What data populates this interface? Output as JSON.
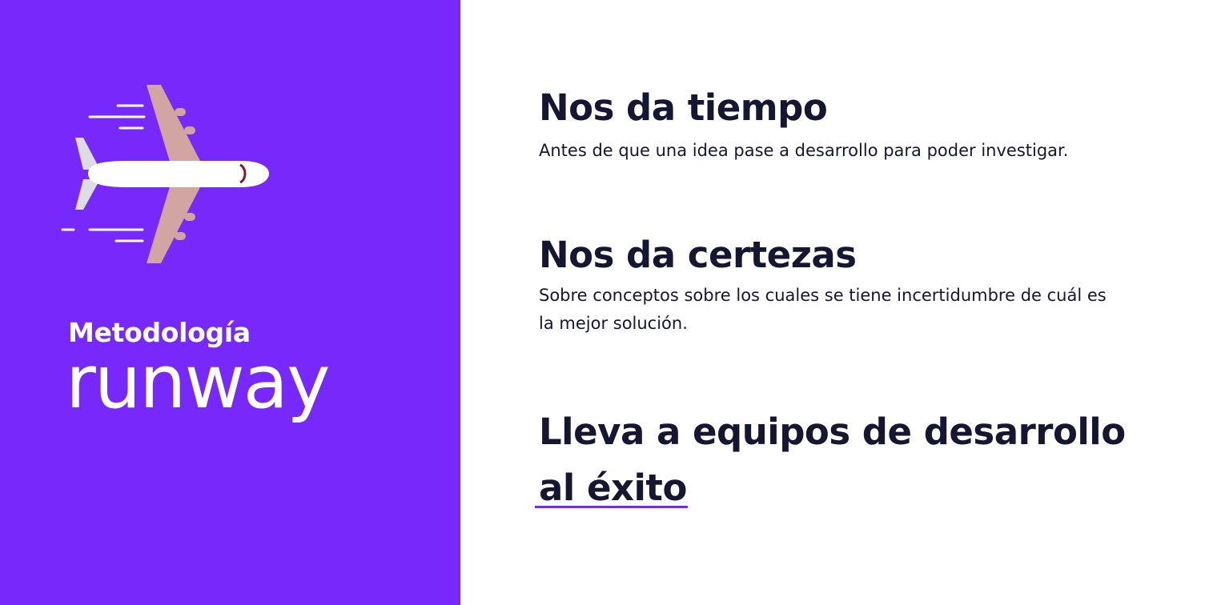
{
  "left": {
    "subtitle": "Metodología",
    "brand": "runway",
    "icon": "airplane-icon",
    "background_color": "#7629fa"
  },
  "sections": [
    {
      "title": "Nos da tiempo",
      "description": "Antes de que una idea pase a desarrollo para poder investigar."
    },
    {
      "title": "Nos da certezas",
      "description": "Sobre conceptos sobre los cuales se tiene incertidumbre de cuál es la mejor solución."
    },
    {
      "title": "Lleva a equipos de desarrollo al éxito"
    }
  ],
  "colors": {
    "accent": "#7629fa",
    "text": "#141632"
  }
}
